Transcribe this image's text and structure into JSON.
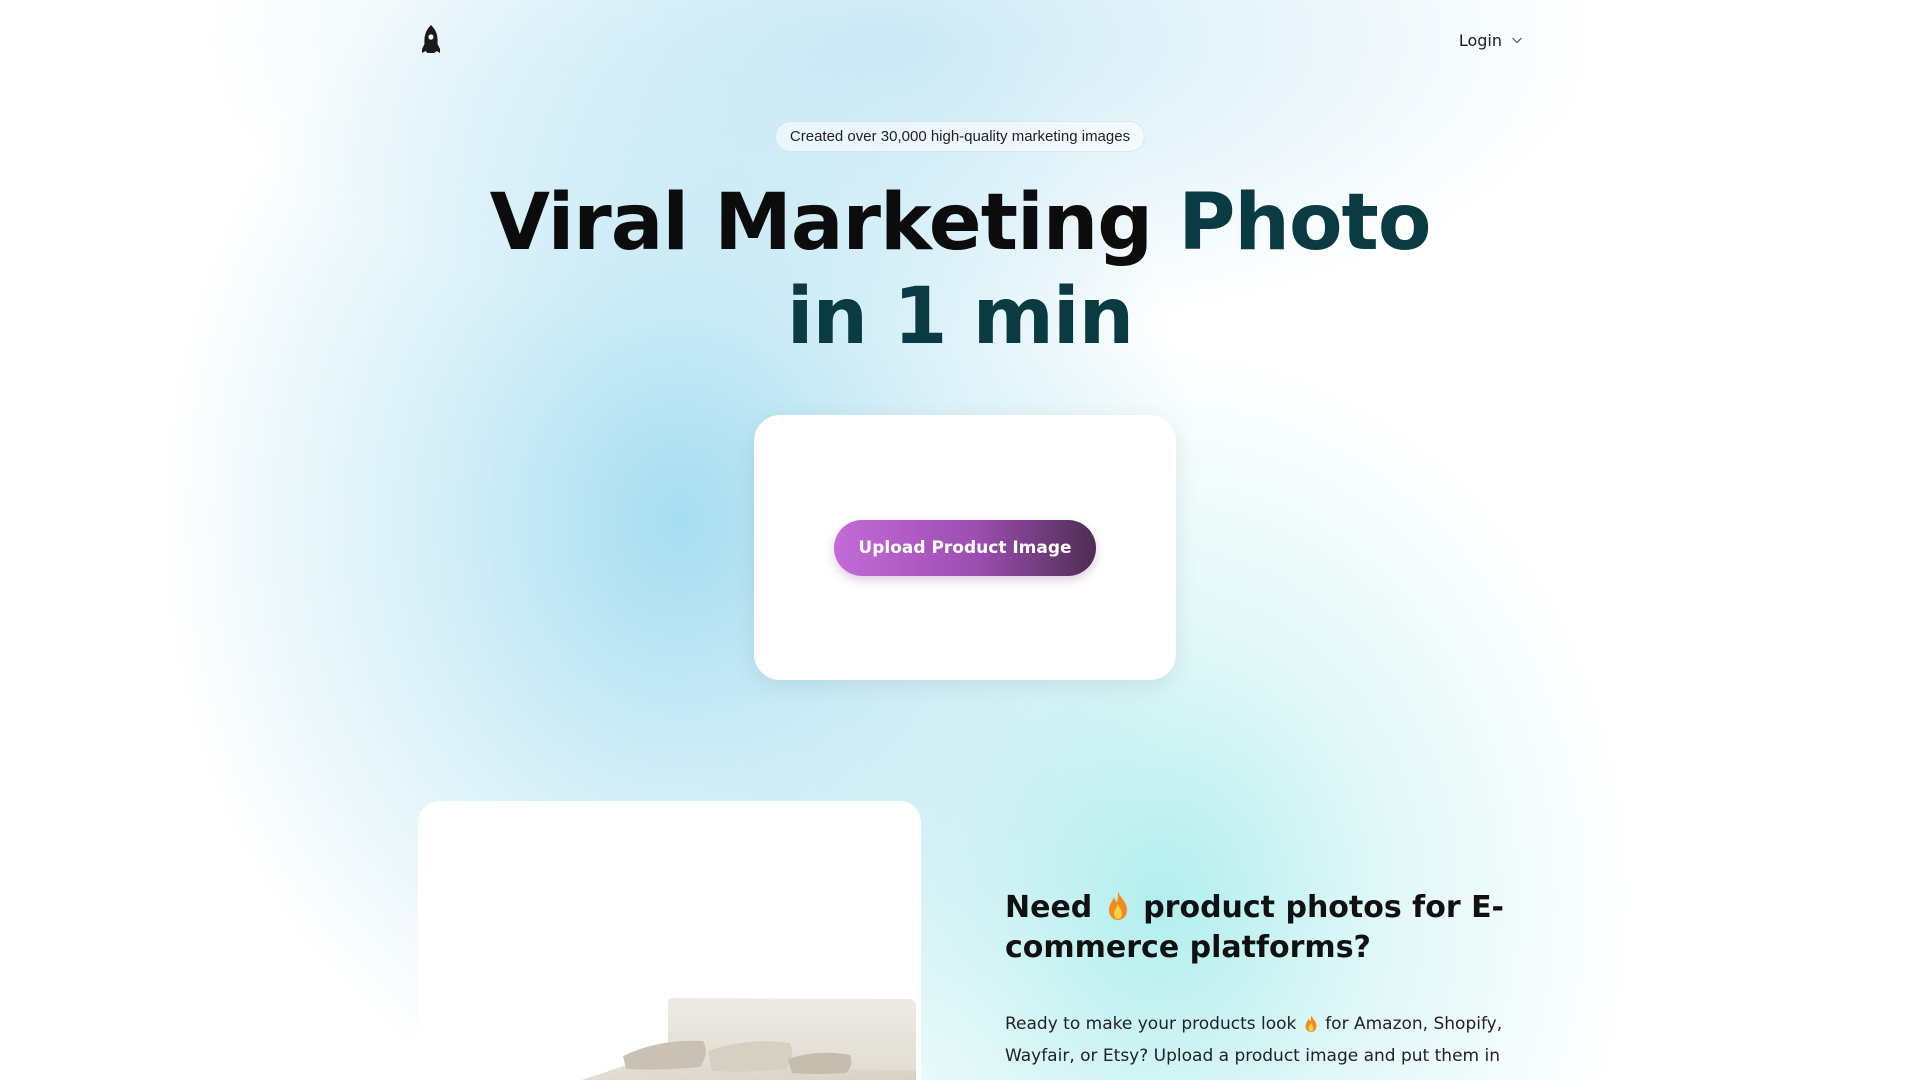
{
  "header": {
    "logo_icon": "rocket-icon",
    "login_label": "Login",
    "login_icon": "chevron-down-icon"
  },
  "hero": {
    "badge": "Created over 30,000 high-quality marketing images",
    "title_part1": "Viral Marketing",
    "title_part2": "Photo",
    "title_line2": "in 1 min"
  },
  "upload": {
    "button_label": "Upload Product Image"
  },
  "feature": {
    "title_before": "Need",
    "title_icon": "fire-icon",
    "title_after": "product photos for E-commerce platforms?",
    "text_before": "Ready to make your products look",
    "text_icon": "fire-icon",
    "text_after": "for Amazon, Shopify, Wayfair, or Etsy? Upload a product image and put them in"
  },
  "colors": {
    "title_dark": "#0c0c0c",
    "title_teal": "#0a3b42",
    "button_start": "#c46ad8",
    "button_end": "#4e2d52"
  }
}
